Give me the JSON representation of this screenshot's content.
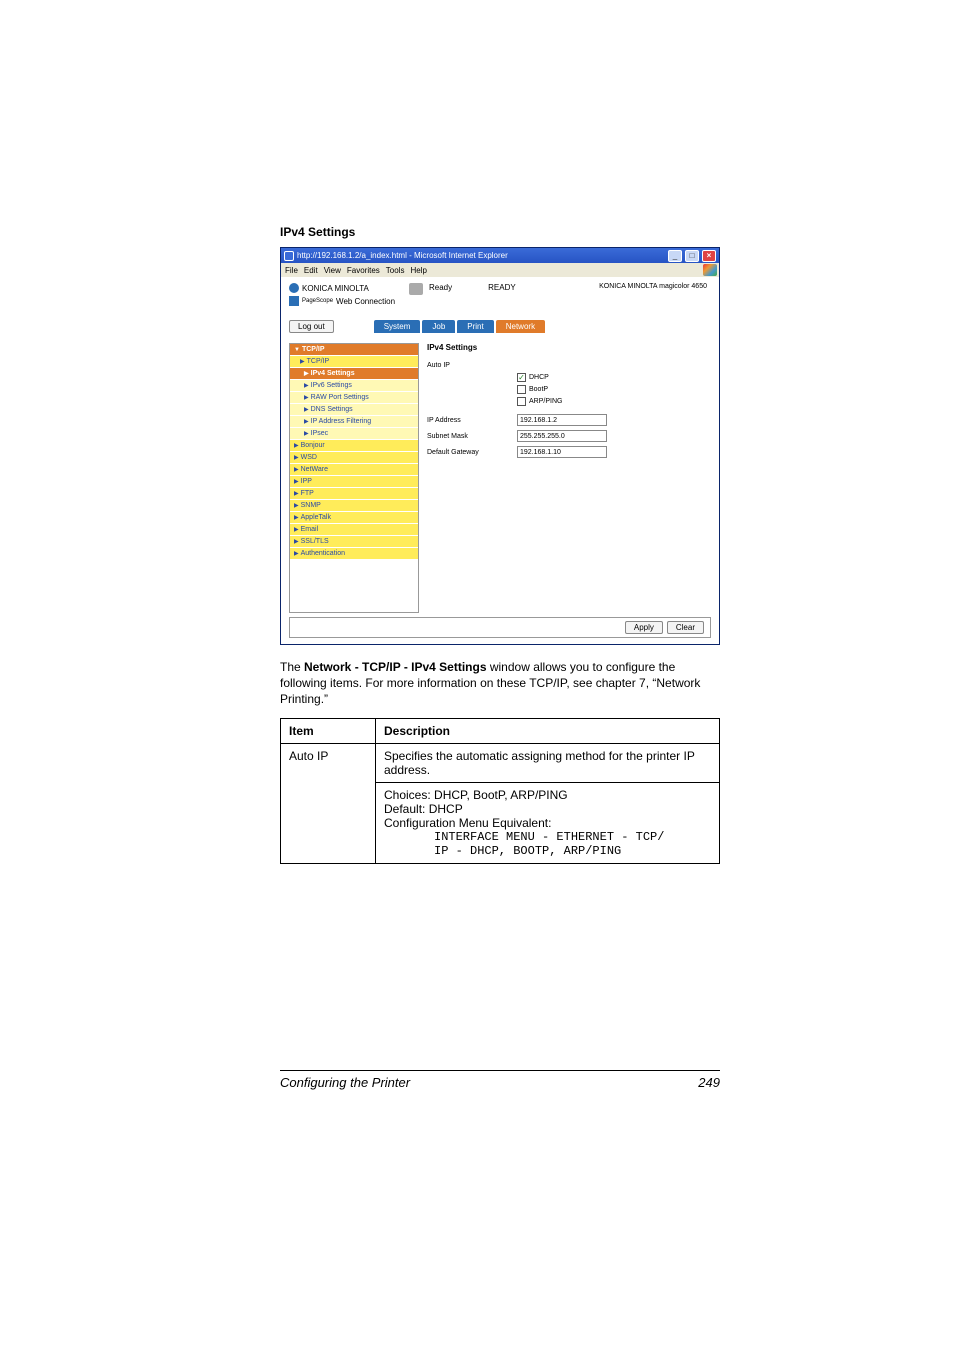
{
  "section_heading": "IPv4 Settings",
  "browser": {
    "titlebar": "http://192.168.1.2/a_index.html - Microsoft Internet Explorer",
    "menus": [
      "File",
      "Edit",
      "View",
      "Favorites",
      "Tools",
      "Help"
    ],
    "brand": "KONICA MINOLTA",
    "pagescope_label": "PageScope",
    "webconn_label": "Web Connection",
    "ready_label": "Ready",
    "ready_status": "READY",
    "model": "KONICA MINOLTA magicolor 4650",
    "logout": "Log out",
    "tabs": {
      "system": "System",
      "job": "Job",
      "print": "Print",
      "network": "Network"
    },
    "nav": {
      "tcpip": "TCP/IP",
      "tcpip2": "TCP/IP",
      "ipv4": "IPv4 Settings",
      "ipv6": "IPv6 Settings",
      "rawport": "RAW Port Settings",
      "dns": "DNS Settings",
      "ipfilt": "IP Address Filtering",
      "ipsec": "IPsec",
      "bonjour": "Bonjour",
      "wsd": "WSD",
      "netware": "NetWare",
      "ipp": "IPP",
      "ftp": "FTP",
      "snmp": "SNMP",
      "appletalk": "AppleTalk",
      "email": "Email",
      "ssltls": "SSL/TLS",
      "auth": "Authentication"
    },
    "panel_title": "IPv4 Settings",
    "form": {
      "autoip_label": "Auto IP",
      "chk_dhcp": "DHCP",
      "chk_bootp": "BootP",
      "chk_arpping": "ARP/PING",
      "ipaddr_label": "IP Address",
      "ipaddr_value": "192.168.1.2",
      "subnet_label": "Subnet Mask",
      "subnet_value": "255.255.255.0",
      "gateway_label": "Default Gateway",
      "gateway_value": "192.168.1.10"
    },
    "apply": "Apply",
    "clear": "Clear"
  },
  "body_text_pre": "The ",
  "body_text_bold": "Network - TCP/IP - IPv4 Settings",
  "body_text_post": " window allows you to configure the following items. For more information on these TCP/IP, see chapter 7,  “Network Printing.”",
  "table": {
    "h_item": "Item",
    "h_desc": "Description",
    "r1_item": "Auto IP",
    "r1_desc1": "Specifies the automatic assigning method for the printer IP address.",
    "r1_desc2_l1": "Choices: DHCP, BootP, ARP/PING",
    "r1_desc2_l2": "Default:  DHCP",
    "r1_desc2_l3": "Configuration Menu Equivalent:",
    "r1_code1": "INTERFACE MENU - ETHERNET - TCP/",
    "r1_code2": "IP - DHCP, BOOTP, ARP/PING"
  },
  "footer_title": "Configuring the Printer",
  "footer_page": "249"
}
